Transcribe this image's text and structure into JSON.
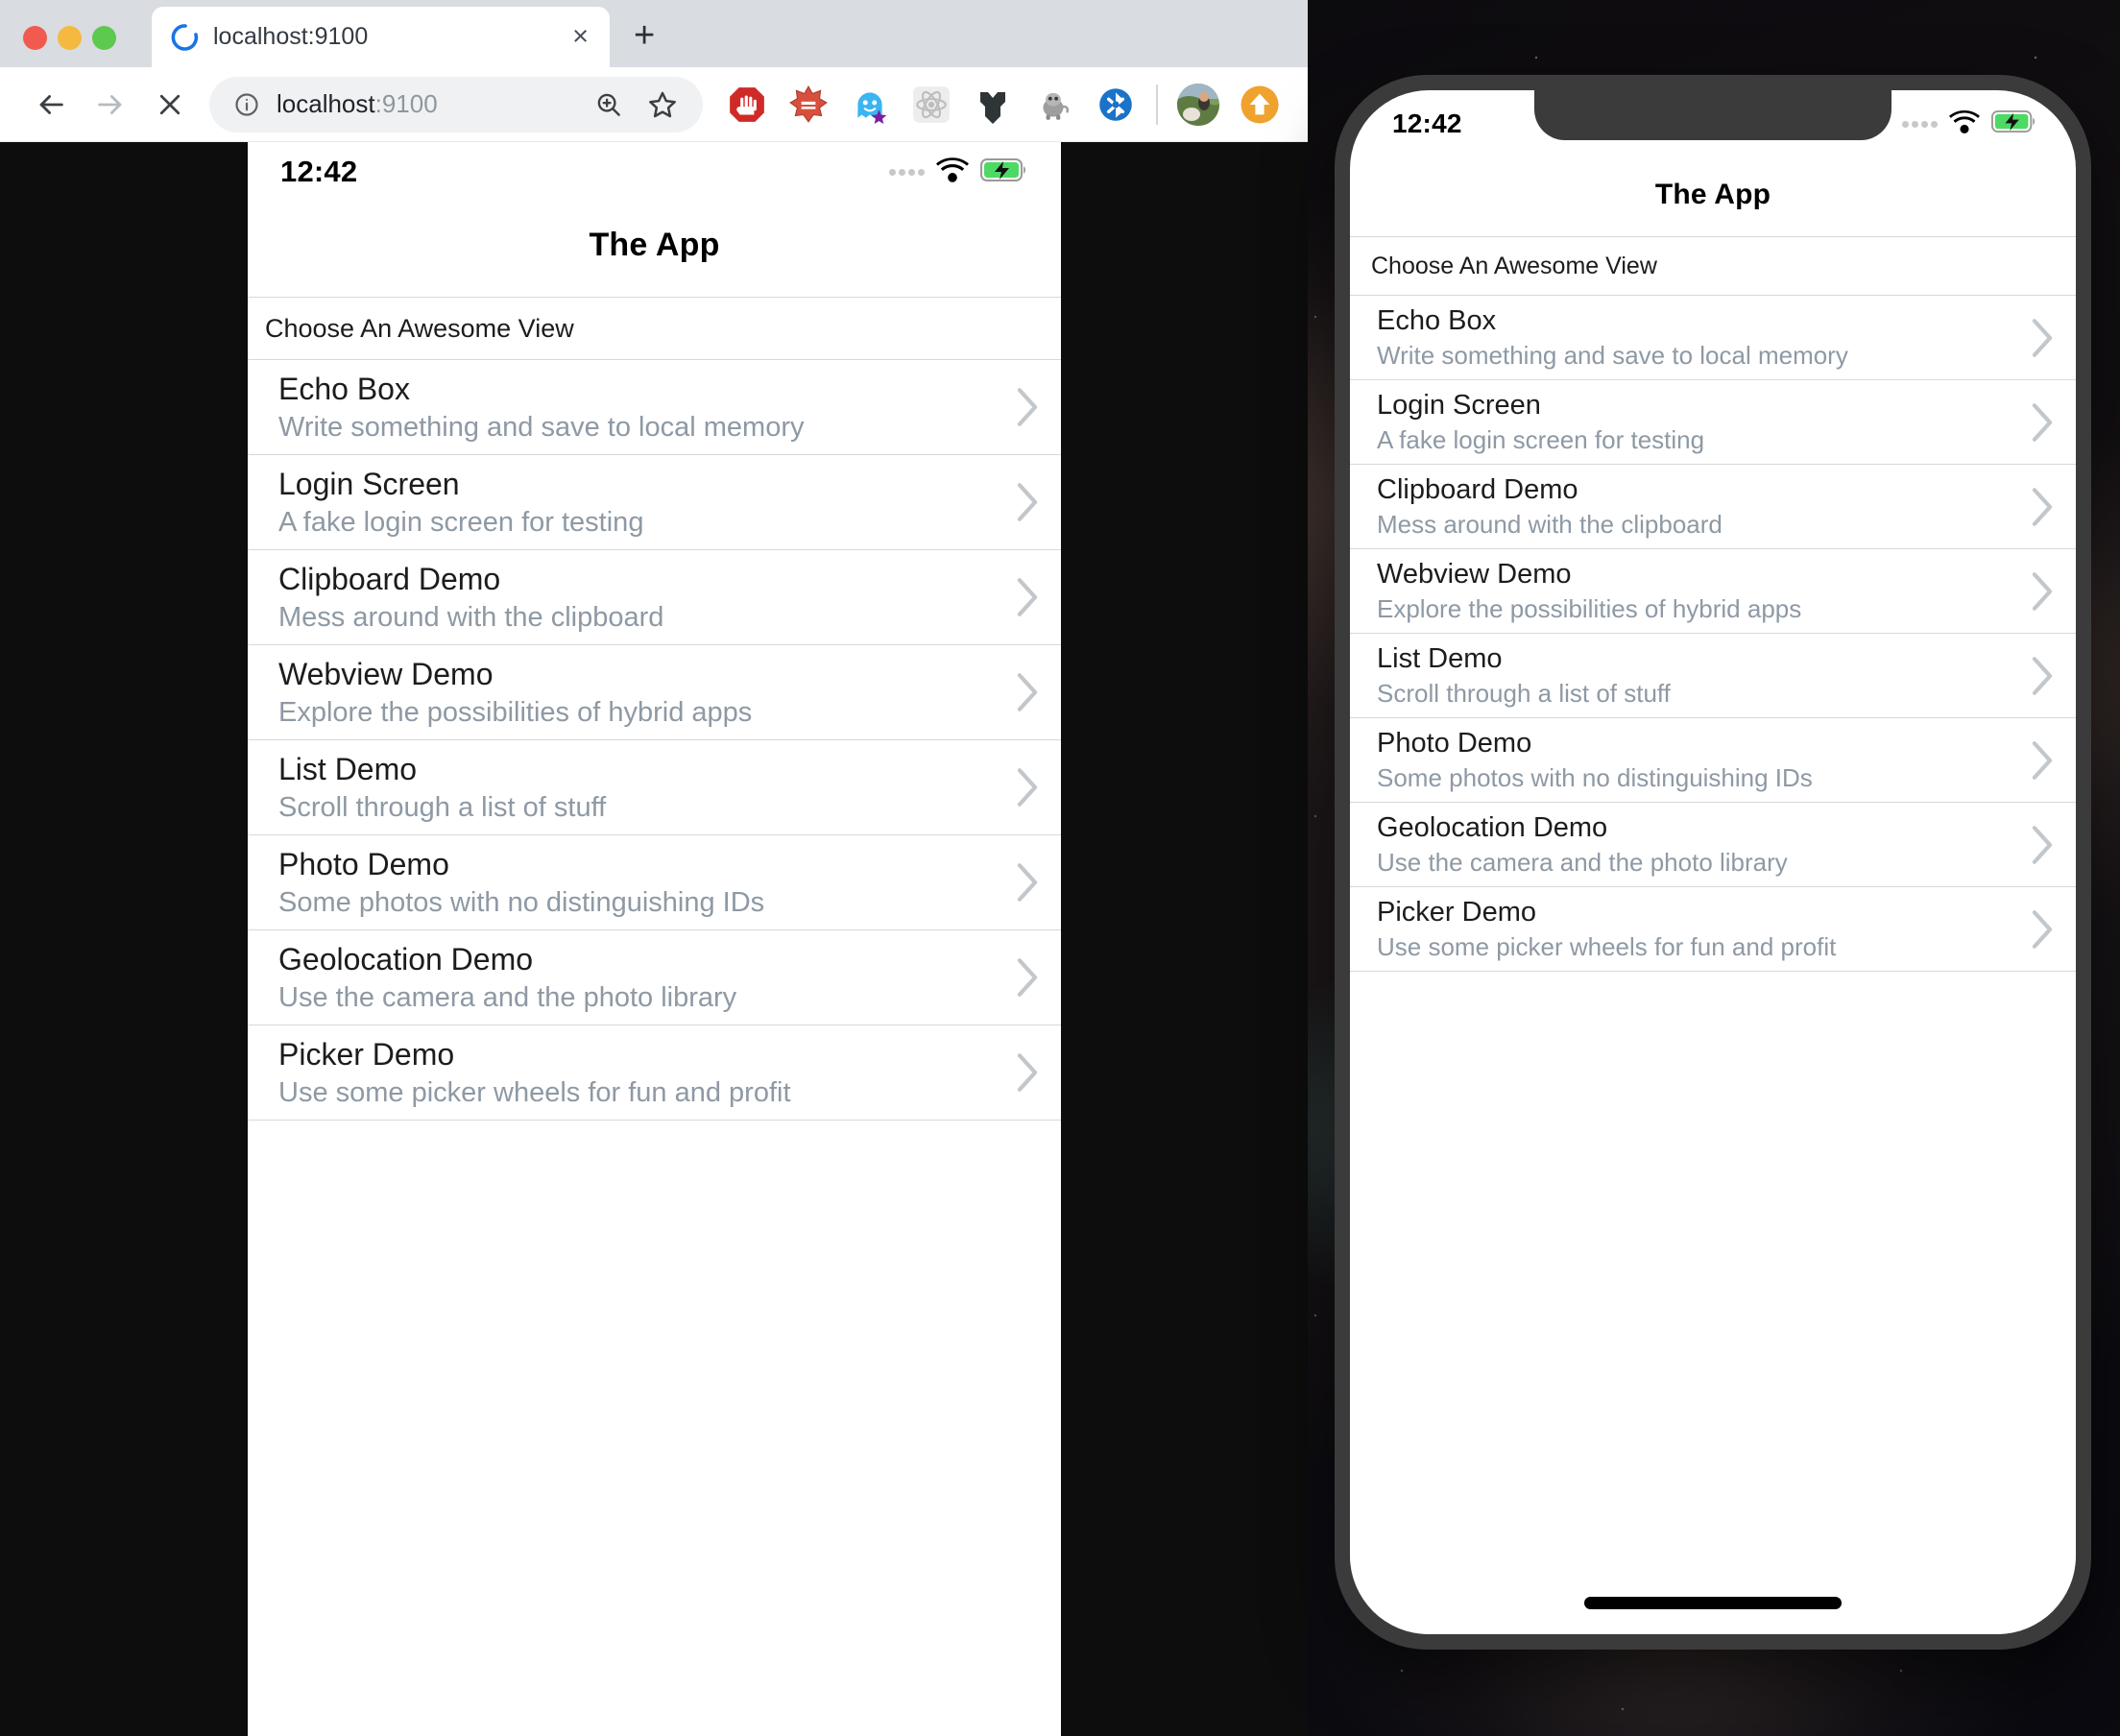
{
  "browser": {
    "traffic_lights": [
      "close",
      "minimize",
      "maximize"
    ],
    "tab": {
      "title": "localhost:9100",
      "close_label": "×",
      "favicon": "loading-spinner-icon"
    },
    "new_tab_label": "+",
    "nav": {
      "back_label": "Back",
      "forward_label": "Forward",
      "stop_label": "Stop"
    },
    "urlbar": {
      "scheme_host": "localhost",
      "port": ":9100",
      "full_url": "localhost:9100",
      "info_icon": "site-info-icon",
      "zoom_icon": "zoom-in-icon",
      "bookmark_icon": "star-outline-icon"
    },
    "extensions": [
      {
        "name": "ublock-origin-extension-icon",
        "color": "#cf2a27"
      },
      {
        "name": "clippy-extension-icon",
        "color": "#d94f3d"
      },
      {
        "name": "ghostery-extension-icon",
        "color": "#3ab5f1"
      },
      {
        "name": "react-devtools-extension-icon",
        "color": "#9b9b9b"
      },
      {
        "name": "bitwarden-extension-icon",
        "color": "#2f3437"
      },
      {
        "name": "gnome-shell-extension-icon",
        "color": "#9a9a9a"
      },
      {
        "name": "bluetooth-sync-extension-icon",
        "color": "#1a73c8"
      }
    ],
    "profile": {
      "name": "account-avatar",
      "color": "#6b8b4a"
    },
    "update_button": {
      "name": "update-available-button",
      "color": "#f0a22e"
    }
  },
  "app": {
    "status_bar": {
      "time": "12:42",
      "signal_icon": "signal-dots-icon",
      "wifi_icon": "wifi-icon",
      "battery_icon": "battery-charging-icon",
      "battery_color": "#4cd964"
    },
    "nav_title": "The App",
    "section_header": "Choose An Awesome View",
    "chevron_icon": "chevron-right-icon",
    "rows": [
      {
        "title": "Echo Box",
        "subtitle": "Write something and save to local memory"
      },
      {
        "title": "Login Screen",
        "subtitle": "A fake login screen for testing"
      },
      {
        "title": "Clipboard Demo",
        "subtitle": "Mess around with the clipboard"
      },
      {
        "title": "Webview Demo",
        "subtitle": "Explore the possibilities of hybrid apps"
      },
      {
        "title": "List Demo",
        "subtitle": "Scroll through a list of stuff"
      },
      {
        "title": "Photo Demo",
        "subtitle": "Some photos with no distinguishing IDs"
      },
      {
        "title": "Geolocation Demo",
        "subtitle": "Use the camera and the photo library"
      },
      {
        "title": "Picker Demo",
        "subtitle": "Use some picker wheels for fun and profit"
      }
    ]
  },
  "iphone": {
    "home_indicator": "home-indicator-bar",
    "notch": "notch"
  }
}
